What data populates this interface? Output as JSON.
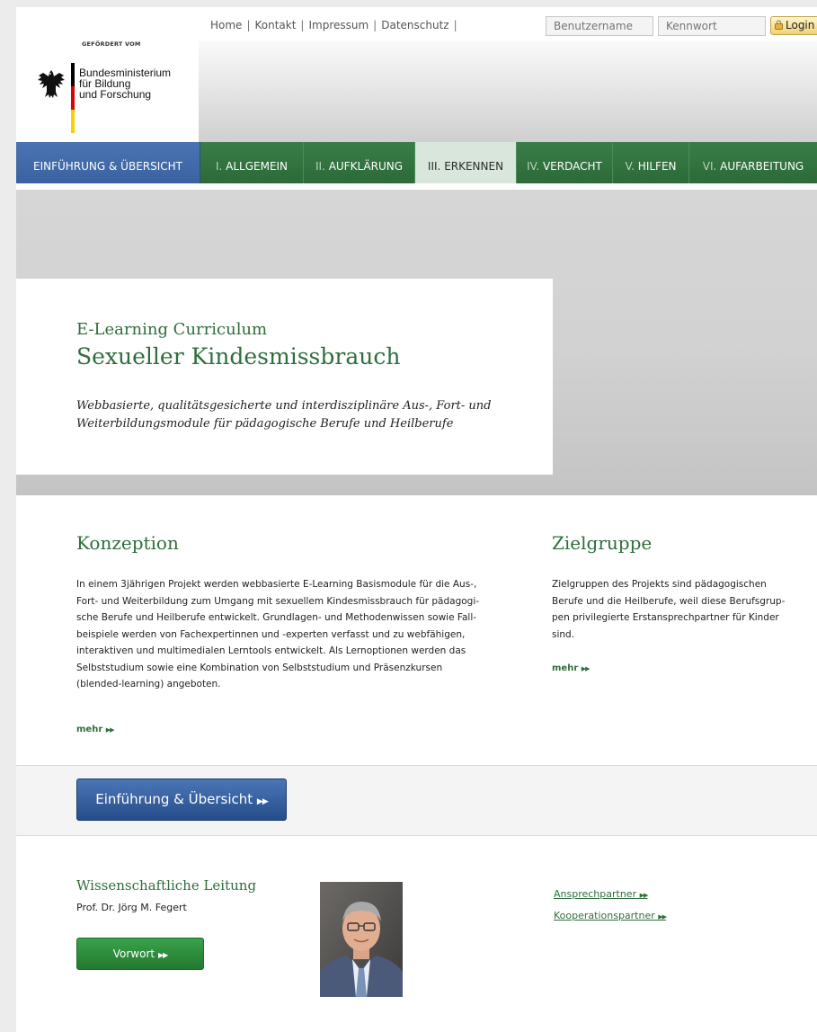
{
  "header": {
    "funded_by": "GEFÖRDERT VOM",
    "ministry_lines": [
      "Bundesministerium",
      "für Bildung",
      "und Forschung"
    ],
    "top_links": [
      "Home",
      "Kontakt",
      "Impressum",
      "Datenschutz"
    ],
    "separator": "|",
    "username_placeholder": "Benutzername",
    "password_placeholder": "Kennwort",
    "login_label": "Login"
  },
  "nav": [
    {
      "num": "",
      "label": "EINFÜHRUNG & ÜBERSICHT"
    },
    {
      "num": "I.",
      "label": "ALLGEMEIN"
    },
    {
      "num": "II.",
      "label": "AUFKLÄRUNG"
    },
    {
      "num": "III.",
      "label": "ERKENNEN"
    },
    {
      "num": "IV.",
      "label": "VERDACHT"
    },
    {
      "num": "V.",
      "label": "HILFEN"
    },
    {
      "num": "VI.",
      "label": "AUFARBEITUNG"
    }
  ],
  "hero": {
    "subtitle": "E-Learning Curriculum",
    "title": "Sexueller Kindesmissbrauch",
    "description": "Webbasierte, qualitätsgesicherte und interdisziplinäre Aus-, Fort- und Weiterbildungsmodule für pädagogische Berufe und Heilberufe"
  },
  "konzeption": {
    "title": "Konzeption",
    "lines": [
      "In einem 3jährigen Projekt werden webbasierte E-Learning Basismodule für die Aus-,",
      "Fort- und Weiterbildung zum Umgang mit sexuellem Kindesmissbrauch für pädagogi-",
      "sche Berufe und Heilberufe entwickelt. Grundlagen- und Methodenwissen sowie Fall-",
      "beispiele werden von Fachexpertinnen und -experten verfasst und zu webfähigen,",
      "interaktiven und multimedialen Lerntools entwickelt. Als Lernoptionen werden das",
      "Selbststudium sowie eine Kombination von Selbststudium und Präsenzkursen",
      "(blended-learning) angeboten."
    ],
    "more": "mehr"
  },
  "zielgruppe": {
    "title": "Zielgruppe",
    "lines": [
      "Zielgruppen des Projekts sind pädagogischen",
      "Berufe und die Heilberufe, weil diese Berufsgrup-",
      "pen privilegierte Erstansprechpartner für Kinder",
      "sind."
    ],
    "more": "mehr"
  },
  "cta": {
    "label": "Einführung & Übersicht"
  },
  "leitung": {
    "title": "Wissenschaftliche Leitung",
    "name": "Prof. Dr. Jörg M. Fegert",
    "button": "Vorwort"
  },
  "links": [
    "Ansprechpartner",
    "Kooperationspartner"
  ],
  "colors": {
    "green": "#2f6e3c",
    "nav_green": "#2c6a39",
    "nav_blue": "#3b62a0",
    "nav_active": "#d9e6db"
  }
}
